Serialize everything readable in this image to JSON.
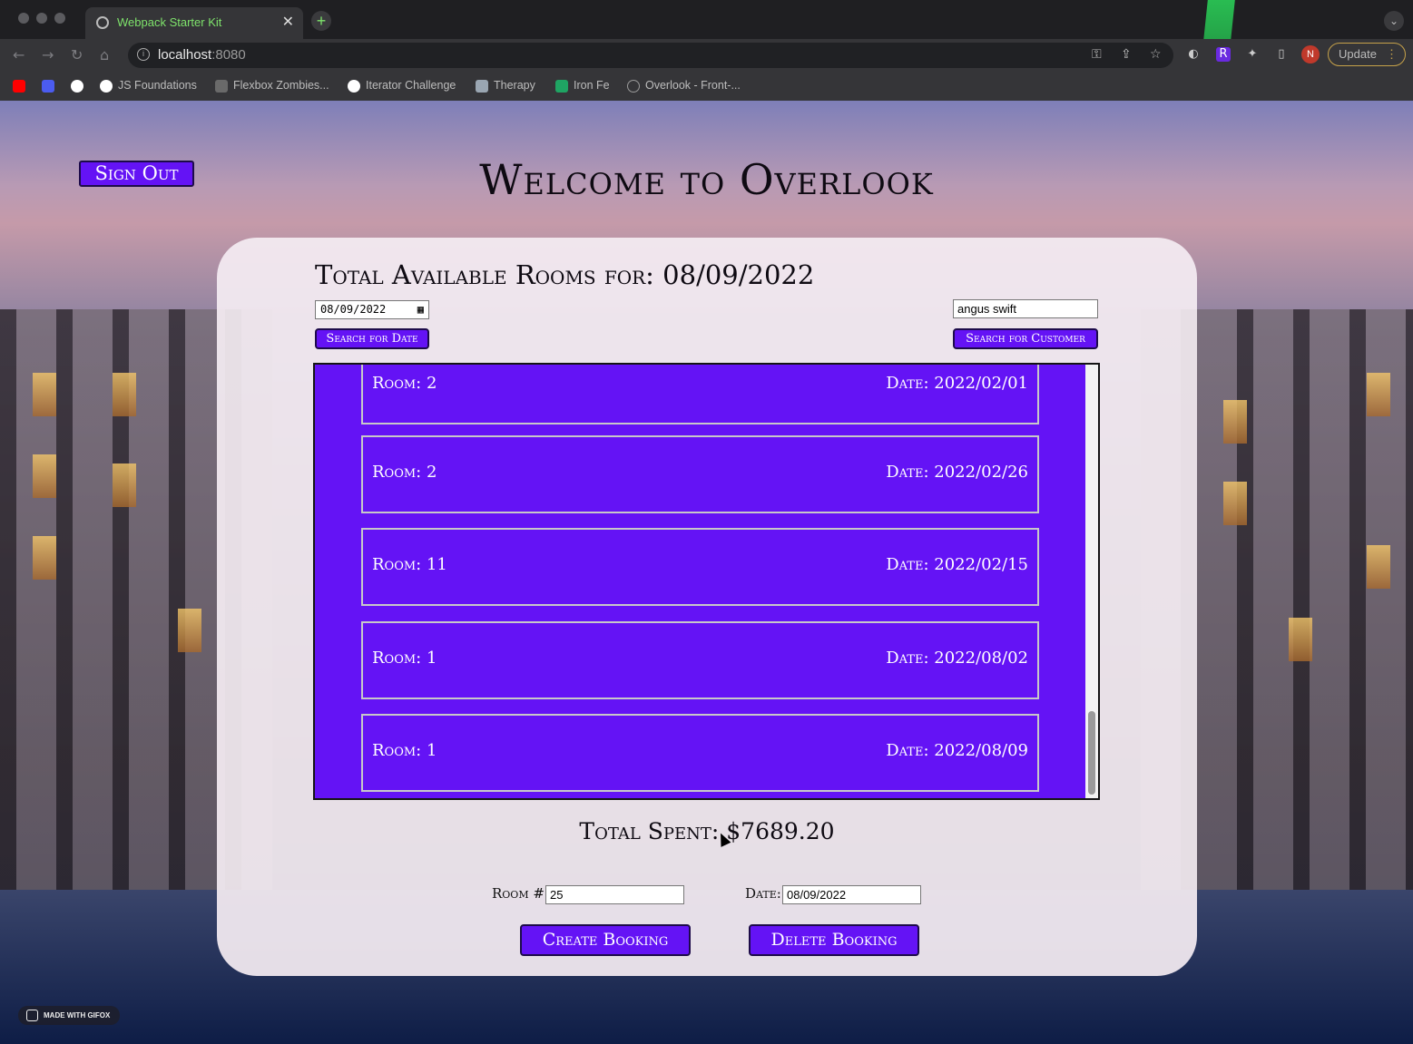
{
  "browser": {
    "tab_title": "Webpack Starter Kit",
    "tab_close": "✕",
    "new_tab": "+",
    "url_host": "localhost",
    "url_port": ":8080",
    "update_label": "Update",
    "avatar_initial": "N",
    "bookmarks": [
      {
        "label": "",
        "icon": "youtube-icon",
        "color": "#ff0000"
      },
      {
        "label": "",
        "icon": "mail-icon",
        "color": "#4b5cf0"
      },
      {
        "label": "",
        "icon": "github-icon",
        "color": "#ffffff"
      },
      {
        "label": "JS Foundations",
        "icon": "github-icon",
        "color": "#ffffff"
      },
      {
        "label": "Flexbox Zombies...",
        "icon": "zombie-icon",
        "color": "#8a8a8a"
      },
      {
        "label": "Iterator Challenge",
        "icon": "chrome-icon",
        "color": "#ffffff"
      },
      {
        "label": "Therapy",
        "icon": "puzzle-icon",
        "color": "#9aa6b2"
      },
      {
        "label": "Iron Fe",
        "icon": "sheet-icon",
        "color": "#1fa463"
      },
      {
        "label": "Overlook - Front-...",
        "icon": "globe-icon",
        "color": "#9a9a9a"
      }
    ]
  },
  "app": {
    "sign_out_label": "Sign Out",
    "welcome_title": "Welcome to Overlook",
    "rooms_title": "Total Available Rooms for: 08/09/2022",
    "date_input_value": "08/09/2022",
    "customer_input_value": "angus swift",
    "search_date_label": "Search for Date",
    "search_customer_label": "Search for Customer",
    "bookings": [
      {
        "room": "Room: 2",
        "date": "Date: 2022/02/01"
      },
      {
        "room": "Room: 2",
        "date": "Date: 2022/02/26"
      },
      {
        "room": "Room: 11",
        "date": "Date: 2022/02/15"
      },
      {
        "room": "Room: 1",
        "date": "Date: 2022/08/02"
      },
      {
        "room": "Room: 1",
        "date": "Date: 2022/08/09"
      }
    ],
    "total_spent": "Total Spent: $7689.20",
    "room_label": "Room #:",
    "room_value": "25",
    "date_label": "Date:",
    "date_value": "08/09/2022",
    "create_label": "Create Booking",
    "delete_label": "Delete Booking"
  },
  "watermark": "MADE WITH GIFOX",
  "colors": {
    "accent": "#6413f5",
    "panel": "#f4ecf2"
  }
}
